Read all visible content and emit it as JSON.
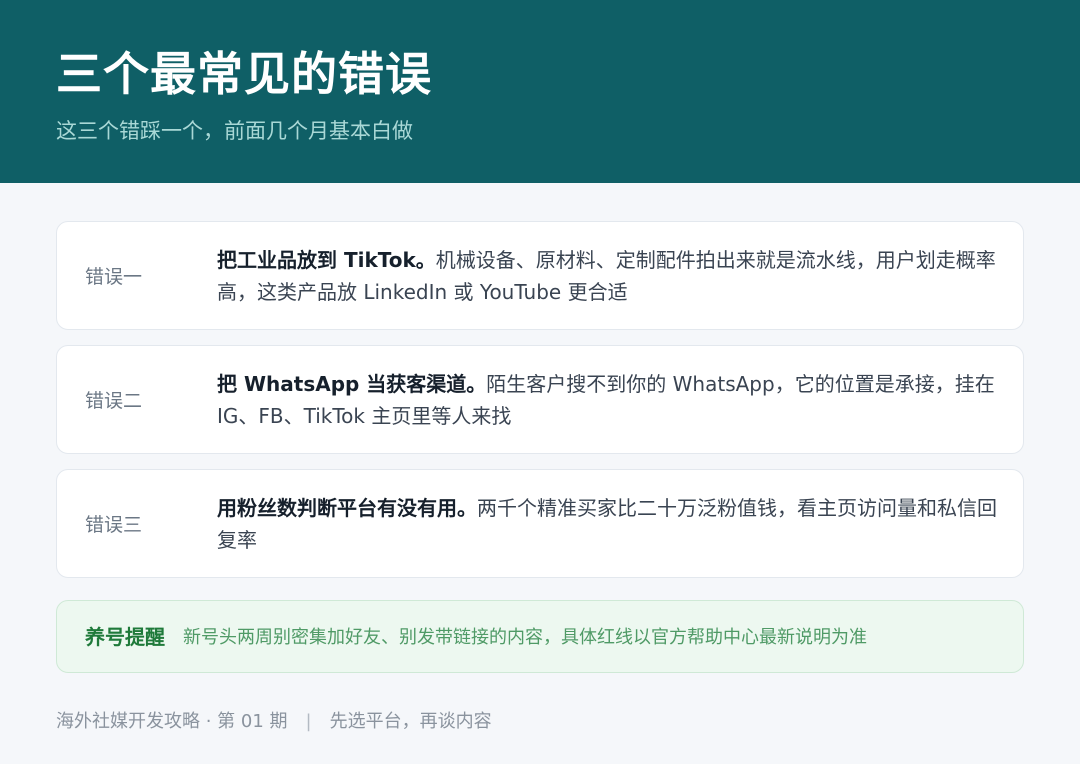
{
  "header": {
    "title": "三个最常见的错误",
    "subtitle": "这三个错踩一个，前面几个月基本白做"
  },
  "mistakes": [
    {
      "tag": "错误一",
      "lead": "把工业品放到 TikTok。",
      "text": "机械设备、原材料、定制配件拍出来就是流水线，用户划走概率高，这类产品放 LinkedIn 或 YouTube 更合适"
    },
    {
      "tag": "错误二",
      "lead": "把 WhatsApp 当获客渠道。",
      "text": "陌生客户搜不到你的 WhatsApp，它的位置是承接，挂在 IG、FB、TikTok 主页里等人来找"
    },
    {
      "tag": "错误三",
      "lead": "用粉丝数判断平台有没有用。",
      "text": "两千个精准买家比二十万泛粉值钱，看主页访问量和私信回复率"
    }
  ],
  "tip": {
    "label": "养号提醒",
    "text": "新号头两周别密集加好友、别发带链接的内容，具体红线以官方帮助中心最新说明为准"
  },
  "footer": {
    "series": "海外社媒开发攻略 · 第 01 期",
    "separator": "|",
    "tagline": "先选平台，再谈内容"
  }
}
